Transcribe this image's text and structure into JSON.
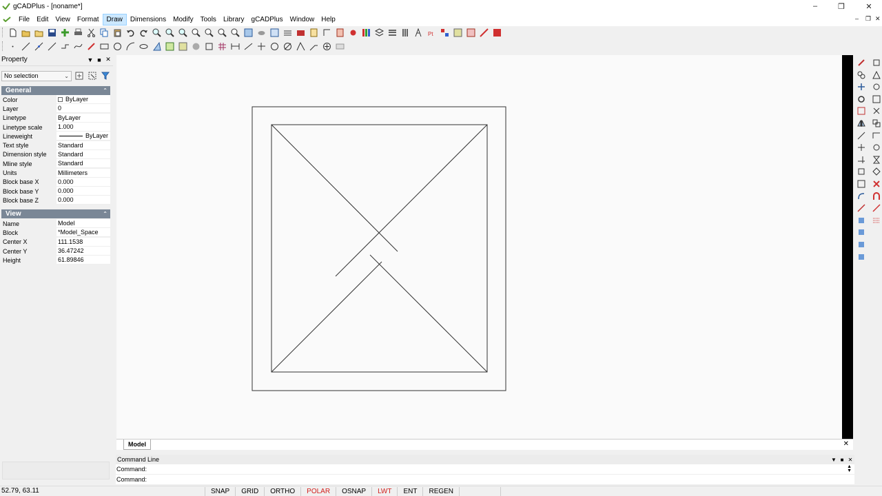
{
  "window": {
    "title": "gCADPlus - [noname*]"
  },
  "menu": {
    "items": [
      "File",
      "Edit",
      "View",
      "Format",
      "Draw",
      "Dimensions",
      "Modify",
      "Tools",
      "Library",
      "gCADPlus",
      "Window",
      "Help"
    ],
    "active": "Draw"
  },
  "property_panel": {
    "title": "Property",
    "selection": "No selection",
    "general": {
      "title": "General",
      "rows": [
        {
          "key": "Color",
          "value": "ByLayer"
        },
        {
          "key": "Layer",
          "value": "0"
        },
        {
          "key": "Linetype",
          "value": "ByLayer"
        },
        {
          "key": "Linetype scale",
          "value": "1.000"
        },
        {
          "key": "Lineweight",
          "value": "ByLayer"
        },
        {
          "key": "Text style",
          "value": "Standard"
        },
        {
          "key": "Dimension style",
          "value": "Standard"
        },
        {
          "key": "Mline style",
          "value": "Standard"
        },
        {
          "key": "Units",
          "value": "Millimeters"
        },
        {
          "key": "Block base X",
          "value": "0.000"
        },
        {
          "key": "Block base Y",
          "value": "0.000"
        },
        {
          "key": "Block base Z",
          "value": "0.000"
        }
      ]
    },
    "view": {
      "title": "View",
      "rows": [
        {
          "key": "Name",
          "value": "Model"
        },
        {
          "key": "Block",
          "value": "*Model_Space"
        },
        {
          "key": "Center X",
          "value": "111.1538"
        },
        {
          "key": "Center Y",
          "value": "36.47242"
        },
        {
          "key": "Height",
          "value": "61.89846"
        }
      ]
    }
  },
  "tabs": {
    "model": "Model"
  },
  "command_line": {
    "title": "Command Line",
    "lines": [
      "Command:",
      "Command:"
    ]
  },
  "status": {
    "coords": "52.79, 63.11",
    "buttons": [
      {
        "label": "SNAP",
        "on": false
      },
      {
        "label": "GRID",
        "on": false
      },
      {
        "label": "ORTHO",
        "on": false
      },
      {
        "label": "POLAR",
        "on": true
      },
      {
        "label": "OSNAP",
        "on": false
      },
      {
        "label": "LWT",
        "on": true
      },
      {
        "label": "ENT",
        "on": false
      },
      {
        "label": "REGEN",
        "on": false
      }
    ]
  },
  "colors": {
    "active_toggle": "#d2201c",
    "section_header": "#7a8796",
    "menu_highlight": "#cce8ff"
  }
}
